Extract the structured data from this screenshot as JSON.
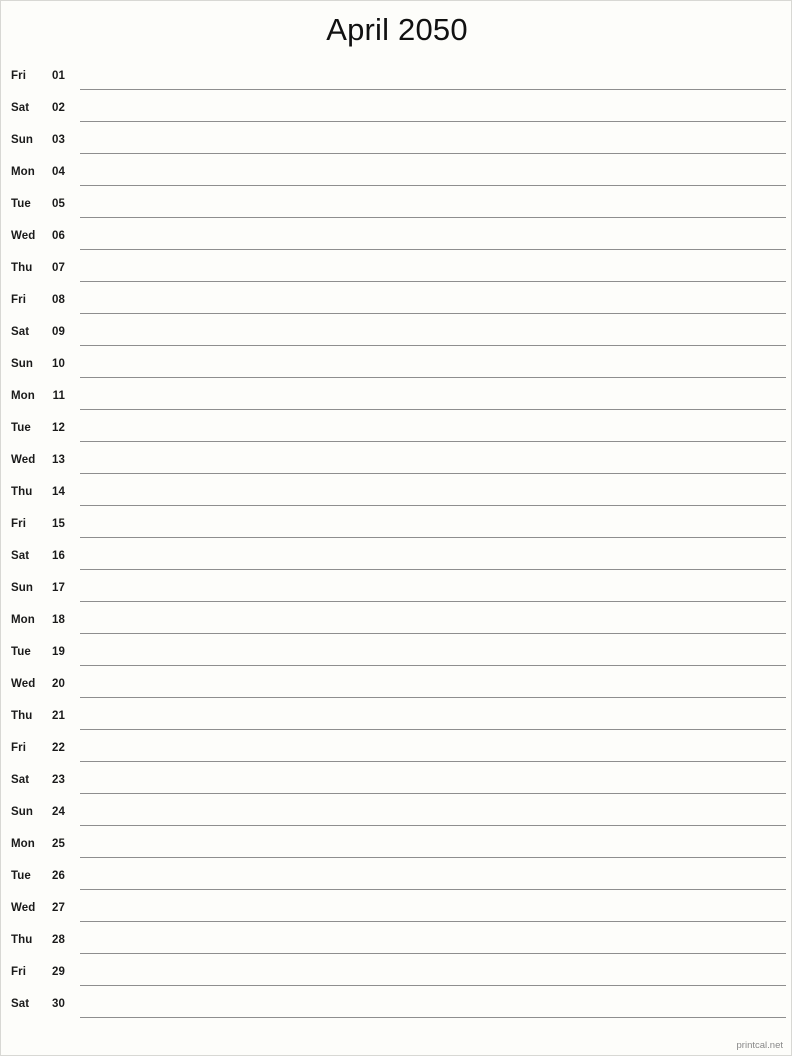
{
  "page": {
    "title": "April 2050",
    "background_color": "#fdfdfa",
    "border_color": "#d8d8d4",
    "rule_color": "#8e8e8e",
    "text_color": "#1a1a1a"
  },
  "footer": {
    "label": "printcal.net",
    "color": "#888888"
  },
  "calendar": {
    "month": "April",
    "year": "2050",
    "rows": [
      {
        "dow": "Fri",
        "day": "01"
      },
      {
        "dow": "Sat",
        "day": "02"
      },
      {
        "dow": "Sun",
        "day": "03"
      },
      {
        "dow": "Mon",
        "day": "04"
      },
      {
        "dow": "Tue",
        "day": "05"
      },
      {
        "dow": "Wed",
        "day": "06"
      },
      {
        "dow": "Thu",
        "day": "07"
      },
      {
        "dow": "Fri",
        "day": "08"
      },
      {
        "dow": "Sat",
        "day": "09"
      },
      {
        "dow": "Sun",
        "day": "10"
      },
      {
        "dow": "Mon",
        "day": "11"
      },
      {
        "dow": "Tue",
        "day": "12"
      },
      {
        "dow": "Wed",
        "day": "13"
      },
      {
        "dow": "Thu",
        "day": "14"
      },
      {
        "dow": "Fri",
        "day": "15"
      },
      {
        "dow": "Sat",
        "day": "16"
      },
      {
        "dow": "Sun",
        "day": "17"
      },
      {
        "dow": "Mon",
        "day": "18"
      },
      {
        "dow": "Tue",
        "day": "19"
      },
      {
        "dow": "Wed",
        "day": "20"
      },
      {
        "dow": "Thu",
        "day": "21"
      },
      {
        "dow": "Fri",
        "day": "22"
      },
      {
        "dow": "Sat",
        "day": "23"
      },
      {
        "dow": "Sun",
        "day": "24"
      },
      {
        "dow": "Mon",
        "day": "25"
      },
      {
        "dow": "Tue",
        "day": "26"
      },
      {
        "dow": "Wed",
        "day": "27"
      },
      {
        "dow": "Thu",
        "day": "28"
      },
      {
        "dow": "Fri",
        "day": "29"
      },
      {
        "dow": "Sat",
        "day": "30"
      }
    ]
  }
}
